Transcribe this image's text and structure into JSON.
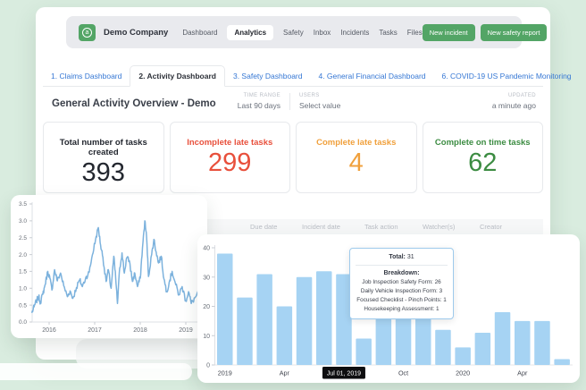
{
  "theme": {
    "background": "#d9ecdf",
    "accent_green": "#53a566",
    "tab_blue": "#3577d4",
    "bar_color": "#a6d3f3",
    "line_color": "#7cb2dd"
  },
  "nav": {
    "brand": "Demo Company",
    "logo_letter": "a",
    "items": [
      {
        "label": "Dashboard"
      },
      {
        "label": "Analytics",
        "active": true
      },
      {
        "label": "Safety"
      },
      {
        "label": "Inbox"
      },
      {
        "label": "Incidents"
      },
      {
        "label": "Tasks"
      },
      {
        "label": "Files"
      }
    ],
    "buttons": [
      {
        "label": "New incident"
      },
      {
        "label": "New safety report"
      }
    ]
  },
  "tabs": [
    {
      "label": "1. Claims Dashboard"
    },
    {
      "label": "2. Activity Dashboard",
      "active": true
    },
    {
      "label": "3. Safety Dashboard"
    },
    {
      "label": "4. General Financial Dashboard"
    },
    {
      "label": "6. COVID-19 US Pandemic Monitoring"
    }
  ],
  "overview": {
    "title": "General Activity Overview - Demo",
    "time_range_label": "TIME RANGE",
    "time_range_value": "Last 90 days",
    "users_label": "USERS",
    "users_value": "Select value",
    "updated_label": "UPDATED",
    "updated_value": "a minute ago"
  },
  "stats": [
    {
      "label": "Total number of tasks created",
      "value": "393",
      "color": "#23272f"
    },
    {
      "label": "Incomplete late tasks",
      "value": "299",
      "color": "#e8503c"
    },
    {
      "label": "Complete late tasks",
      "value": "4",
      "color": "#f0a03c"
    },
    {
      "label": "Complete on time tasks",
      "value": "62",
      "color": "#3c8c42"
    }
  ],
  "table": {
    "columns": [
      "Due date",
      "Incident date",
      "Task action",
      "Watcher(s)",
      "Creator"
    ]
  },
  "bar_tooltip": {
    "total_label": "Total:",
    "total_value": " 31",
    "breakdown_label": "Breakdown:",
    "lines": [
      "Job Inspection Safety Form: 26",
      "Daily Vehicle Inspection Form: 3",
      "Focused Checklist - Pinch Points: 1",
      "Housekeeping Assessment: 1"
    ]
  },
  "chart_data": [
    {
      "type": "line",
      "title": "",
      "xlabel": "",
      "ylabel": "",
      "ylim": [
        0,
        3.5
      ],
      "yticks": [
        0.0,
        0.5,
        1.0,
        1.5,
        2.0,
        2.5,
        3.0,
        3.5
      ],
      "xticks": [
        2016,
        2017,
        2018,
        2019
      ],
      "grid": false,
      "x": [
        2015.62,
        2015.67,
        2015.72,
        2015.77,
        2015.81,
        2015.86,
        2015.91,
        2015.97,
        2016.02,
        2016.06,
        2016.12,
        2016.18,
        2016.25,
        2016.32,
        2016.4,
        2016.46,
        2016.52,
        2016.6,
        2016.67,
        2016.73,
        2016.8,
        2016.88,
        2016.95,
        2017.02,
        2017.08,
        2017.13,
        2017.18,
        2017.25,
        2017.3,
        2017.36,
        2017.42,
        2017.46,
        2017.5,
        2017.55,
        2017.6,
        2017.65,
        2017.7,
        2017.76,
        2017.83,
        2017.88,
        2017.94,
        2018.0,
        2018.05,
        2018.1,
        2018.14,
        2018.18,
        2018.25,
        2018.3,
        2018.35,
        2018.4,
        2018.46,
        2018.52,
        2018.58,
        2018.65,
        2018.7,
        2018.78,
        2018.85,
        2018.92,
        2019.0,
        2019.06,
        2019.12,
        2019.2,
        2019.28,
        2019.35,
        2019.4
      ],
      "y": [
        0.27,
        0.45,
        0.62,
        0.75,
        0.58,
        0.82,
        1.1,
        1.5,
        1.28,
        0.95,
        1.55,
        1.22,
        1.45,
        1.08,
        0.75,
        0.92,
        0.7,
        1.02,
        1.25,
        1.05,
        1.3,
        1.48,
        2.0,
        2.45,
        2.8,
        2.28,
        1.92,
        1.2,
        1.55,
        1.0,
        1.95,
        1.3,
        0.55,
        1.6,
        2.05,
        1.45,
        1.9,
        1.82,
        1.2,
        1.45,
        1.05,
        1.3,
        2.2,
        3.0,
        2.52,
        1.35,
        2.0,
        2.45,
        2.08,
        1.75,
        1.95,
        1.28,
        0.9,
        1.25,
        1.5,
        1.1,
        0.8,
        1.05,
        0.62,
        0.9,
        0.55,
        0.72,
        0.85,
        0.95,
        1.0
      ]
    },
    {
      "type": "bar",
      "title": "",
      "xlabel": "",
      "ylabel": "",
      "ylim": [
        0,
        40
      ],
      "yticks": [
        0,
        10,
        20,
        30,
        40
      ],
      "grid": false,
      "categories": [
        "Jan 2019",
        "Feb 2019",
        "Mar 2019",
        "Apr 2019",
        "May 2019",
        "Jun 2019",
        "Jul 2019",
        "Aug 2019",
        "Sep 2019",
        "Oct 2019",
        "Nov 2019",
        "Dec 2019",
        "Jan 2020",
        "Feb 2020",
        "Mar 2020",
        "Apr 2020",
        "May 2020",
        "Jun 2020"
      ],
      "values": [
        38,
        23,
        31,
        20,
        30,
        32,
        31,
        9,
        16,
        19,
        19,
        12,
        6,
        11,
        18,
        15,
        15,
        2
      ],
      "selected_bar_index": 6,
      "selected_bar_total": 31,
      "x_ticks": [
        {
          "label": "2019",
          "bar": 0
        },
        {
          "label": "Apr",
          "bar": 3
        },
        {
          "label": "Jul 01, 2019",
          "bar": 6,
          "highlight": true
        },
        {
          "label": "Oct",
          "bar": 9
        },
        {
          "label": "2020",
          "bar": 12
        },
        {
          "label": "Apr",
          "bar": 15
        }
      ]
    }
  ]
}
